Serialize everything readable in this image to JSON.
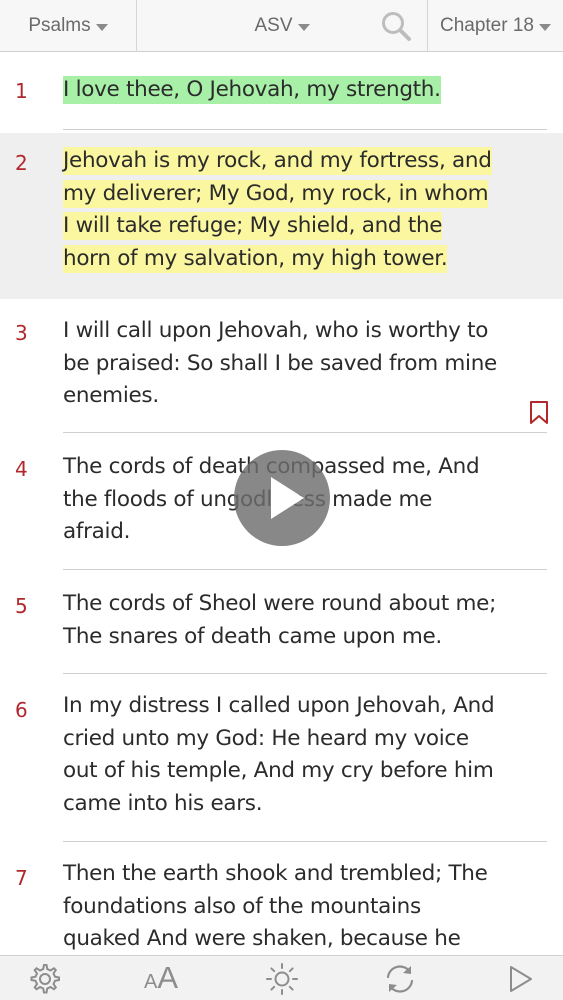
{
  "header": {
    "book": "Psalms",
    "version": "ASV",
    "chapter": "Chapter 18"
  },
  "verses": [
    {
      "number": "1",
      "lines": [
        "I love thee, O Jehovah, my strength."
      ],
      "highlight": "green"
    },
    {
      "number": "2",
      "lines": [
        "Jehovah is my rock, and my fortress, and",
        "my deliverer; My God, my rock, in whom",
        "I will take refuge; My shield, and the",
        "horn of my salvation, my high tower."
      ],
      "highlight": "yellow"
    },
    {
      "number": "3",
      "lines": [
        "I will call upon Jehovah, who is worthy to",
        "be praised: So shall I be saved from mine",
        "enemies."
      ],
      "highlight": ""
    },
    {
      "number": "4",
      "lines": [
        "The cords of death compassed me, And",
        "the floods of ungodliness made me",
        "afraid."
      ],
      "highlight": ""
    },
    {
      "number": "5",
      "lines": [
        "The cords of Sheol were round about me;",
        "The snares of death came upon me."
      ],
      "highlight": ""
    },
    {
      "number": "6",
      "lines": [
        "In my distress I called upon Jehovah, And",
        "cried unto my God: He heard my voice",
        "out of his temple, And my cry before him",
        "came into his ears."
      ],
      "highlight": ""
    },
    {
      "number": "7",
      "lines": [
        "Then the earth shook and trembled; The",
        "foundations also of the mountains",
        "quaked And were shaken, because he"
      ],
      "highlight": ""
    }
  ],
  "toolbar": {
    "font_size_small": "A",
    "font_size_large": "A"
  },
  "colors": {
    "verse_number": "#b0282c",
    "highlight_green": "#a8f0a8",
    "highlight_yellow": "#fbf7a0",
    "bookmark": "#b0282c"
  },
  "icons": [
    "search-icon",
    "bookmark-icon",
    "play-icon",
    "settings-gear-icon",
    "brightness-sun-icon",
    "sync-icon",
    "play-audio-icon"
  ]
}
